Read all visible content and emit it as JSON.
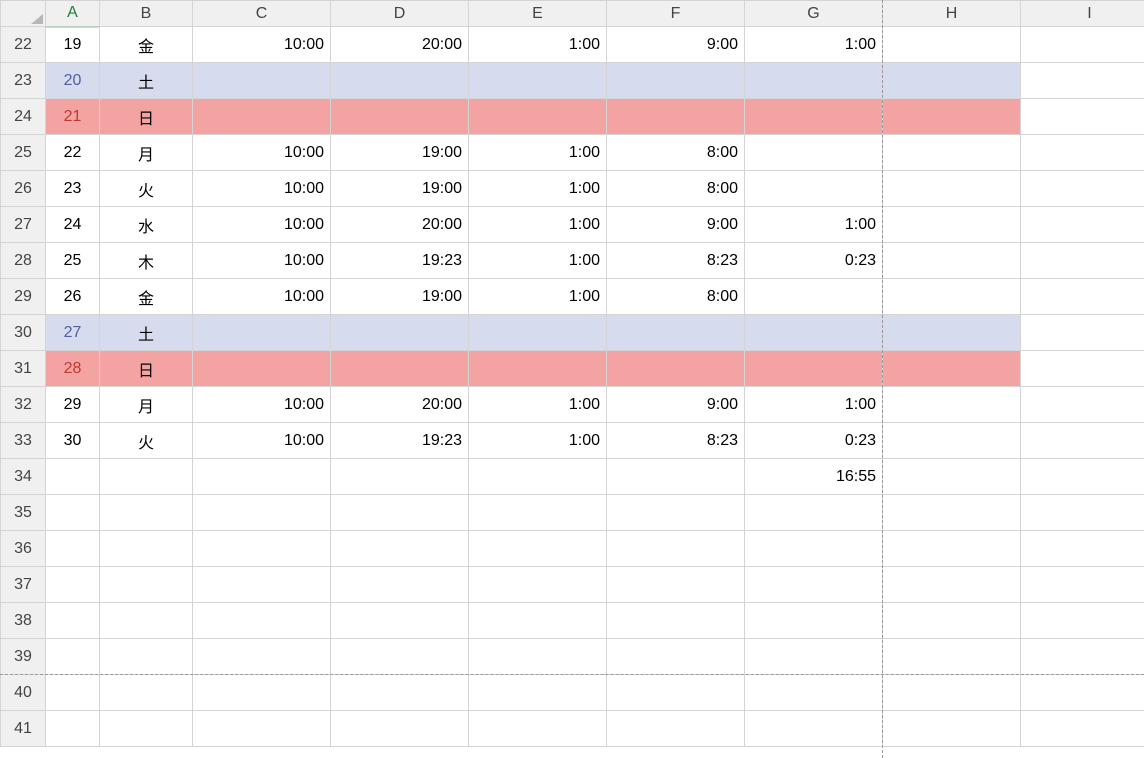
{
  "columns": [
    "A",
    "B",
    "C",
    "D",
    "E",
    "F",
    "G",
    "H",
    "I"
  ],
  "rowNumbers": [
    22,
    23,
    24,
    25,
    26,
    27,
    28,
    29,
    30,
    31,
    32,
    33,
    34,
    35,
    36,
    37,
    38,
    39,
    40,
    41
  ],
  "rows": [
    {
      "n": 22,
      "kind": "normal",
      "A": "19",
      "B": "金",
      "C": "10:00",
      "D": "20:00",
      "E": "1:00",
      "F": "9:00",
      "G": "1:00"
    },
    {
      "n": 23,
      "kind": "sat",
      "A": "20",
      "B": "土"
    },
    {
      "n": 24,
      "kind": "sun",
      "A": "21",
      "B": "日"
    },
    {
      "n": 25,
      "kind": "normal",
      "A": "22",
      "B": "月",
      "C": "10:00",
      "D": "19:00",
      "E": "1:00",
      "F": "8:00"
    },
    {
      "n": 26,
      "kind": "normal",
      "A": "23",
      "B": "火",
      "C": "10:00",
      "D": "19:00",
      "E": "1:00",
      "F": "8:00"
    },
    {
      "n": 27,
      "kind": "normal",
      "A": "24",
      "B": "水",
      "C": "10:00",
      "D": "20:00",
      "E": "1:00",
      "F": "9:00",
      "G": "1:00"
    },
    {
      "n": 28,
      "kind": "normal",
      "A": "25",
      "B": "木",
      "C": "10:00",
      "D": "19:23",
      "E": "1:00",
      "F": "8:23",
      "G": "0:23"
    },
    {
      "n": 29,
      "kind": "normal",
      "A": "26",
      "B": "金",
      "C": "10:00",
      "D": "19:00",
      "E": "1:00",
      "F": "8:00"
    },
    {
      "n": 30,
      "kind": "sat",
      "A": "27",
      "B": "土"
    },
    {
      "n": 31,
      "kind": "sun",
      "A": "28",
      "B": "日"
    },
    {
      "n": 32,
      "kind": "normal",
      "A": "29",
      "B": "月",
      "C": "10:00",
      "D": "20:00",
      "E": "1:00",
      "F": "9:00",
      "G": "1:00"
    },
    {
      "n": 33,
      "kind": "normal",
      "A": "30",
      "B": "火",
      "C": "10:00",
      "D": "19:23",
      "E": "1:00",
      "F": "8:23",
      "G": "0:23"
    },
    {
      "n": 34,
      "kind": "normal",
      "G": "16:55"
    },
    {
      "n": 35,
      "kind": "normal"
    },
    {
      "n": 36,
      "kind": "normal"
    },
    {
      "n": 37,
      "kind": "normal"
    },
    {
      "n": 38,
      "kind": "normal"
    },
    {
      "n": 39,
      "kind": "normal"
    },
    {
      "n": 40,
      "kind": "normal"
    },
    {
      "n": 41,
      "kind": "normal"
    }
  ],
  "guides": {
    "verticalAfterCol": "G",
    "horizontalAfterRow": 39
  }
}
